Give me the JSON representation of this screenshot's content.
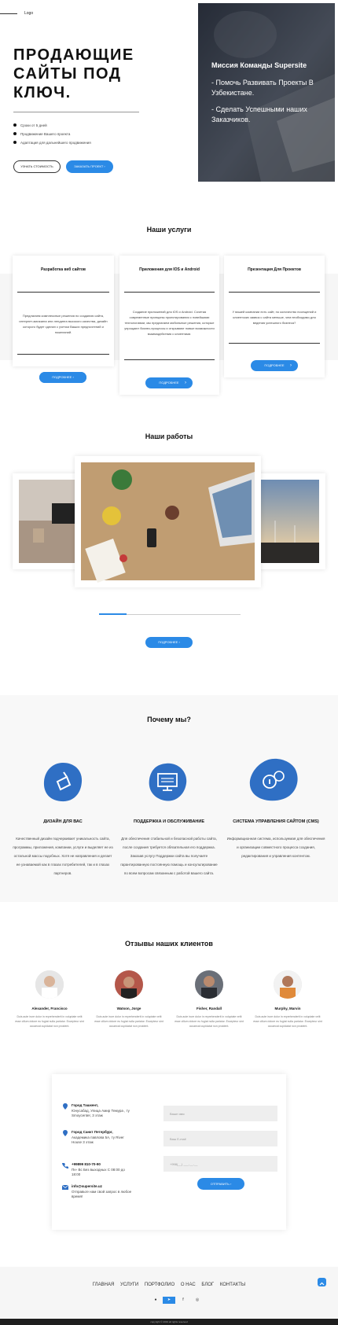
{
  "header": {
    "logo": "Logo"
  },
  "hero": {
    "title": "ПРОДАЮЩИЕ САЙТЫ ПОД КЛЮЧ.",
    "bullets": [
      "Сроки от 5 дней",
      "Продвижение Вашего проекта",
      "Адаптация для дальнейшего продвижения"
    ],
    "btn_price": "УЗНАТЬ СТОИМОСТЬ",
    "btn_order": "ЗАКАЗАТЬ ПРОЕКТ",
    "mission_title": "Миссия Команды Supersite",
    "mission_1": "- Помочь Развивать Проекты В Узбекистане.",
    "mission_2": "- Сделать Успешными наших Заказчиков."
  },
  "services": {
    "title": "Наши услуги",
    "cards": [
      {
        "title": "Разработка веб сайтов",
        "desc": "Предлагаем комплексные решения по созданию сайта, интернет-магазина или лендинга высокого качества, дизайн которого будет сделан с учетом Ваших предпочтений и пожеланий.",
        "btn": "ПОДРОБНЕЕ"
      },
      {
        "title": "Приложения для IOS и Android",
        "desc": "Создание приложений для iOS и Android. Соче­тая современные принципы проектирования с новейшими технологиями, мы предлагаем мобильные решения, которые упрощают бизнес-процессы и открывают новые возможности взаимодействия с клиентами.",
        "btn": "ПОДРОБНЕЕ"
      },
      {
        "title": "Презентация Для Проектов",
        "desc": "У вашей компании есть сайт, но количество посещений и клиентских заявок с сайта меньше, чем необходимо для ведения успешного бизнеса?",
        "btn": "ПОДРОБНЕЕ"
      }
    ]
  },
  "works": {
    "title": "Наши работы",
    "btn": "ПОДРОБНЕЕ"
  },
  "why": {
    "title": "Почему мы?",
    "items": [
      {
        "title": "ДИЗАЙН ДЛЯ ВАС",
        "desc": "Качественный дизайн подчеркивает уникальность сайта, программы, приложения, компании, услуги и выделяет ее из остальной массы подобных. Хотя не направления и делает ее узнаваемой как в глазах потребителей, так и в глазах партнеров."
      },
      {
        "title": "ПОДДЕРЖКА И ОБСЛУЖИВАНИЕ",
        "desc": "Для обеспечения стабильной и безопасной работы сайта, после создания требуется обязательная его поддержка. Заказав услугу Поддержки сайта вы получаете гарантированную постоянную помощь и консультирование по всем вопросам связанным с работой вашего сайта."
      },
      {
        "title": "СИСТЕМА УПРАВЛЕНИЯ САЙТОМ (CMS)",
        "desc": "Информационная система, используемая для обеспечения и организации совместного процесса создания, редактирования и управления контентом."
      }
    ]
  },
  "reviews": {
    "title": "Отзывы наших клиентов",
    "items": [
      {
        "name": "Alexander, Francisco",
        "text": "Duis aute irure dolor in reprehenderit in voluptate velit esse cillum dolore eu fugiat nulla pariatur. Excepteur sint occaecat cupidatat non proident."
      },
      {
        "name": "Watson, Jorge",
        "text": "Duis aute irure dolor in reprehenderit in voluptate velit esse cillum dolore eu fugiat nulla pariatur. Excepteur sint occaecat cupidatat non proident."
      },
      {
        "name": "Fisher, Randall",
        "text": "Duis aute irure dolor in reprehenderit in voluptate velit esse cillum dolore eu fugiat nulla pariatur. Excepteur sint occaecat cupidatat non proident."
      },
      {
        "name": "Murphy, Marvin",
        "text": "Duis aute irure dolor in reprehenderit in voluptate velit esse cillum dolore eu fugiat nulla pariatur. Excepteur sint occaecat cupidatat non proident."
      }
    ]
  },
  "contact": {
    "addr1_title": "Город Ташкент,",
    "addr1": "Юнусабад, Улица Амир Темура , ту Smoycenter, 3 этаж",
    "addr2_title": "Город Санкт Петербург,",
    "addr2": "Академика павлова 5А, ту River House 3 этаж",
    "phone": "+99899 810-70-90",
    "hours": "Пн- Вс Без выходных С 08:00 до 18:00",
    "email": "info@supersite.uz",
    "email_note": "Отправьте нам свой запрос в любое время!",
    "name_ph": "Ваше имя",
    "email_ph": "Ваш E-mail",
    "phone_ph": "+998(__) ___-__-__",
    "send": "ОТПРАВИТЬ"
  },
  "footer": {
    "nav": [
      "ГЛАВНАЯ",
      "УСЛУГИ",
      "ПОРТФОЛИО",
      "О НАС",
      "БЛОГ",
      "КОНТАКТЫ"
    ],
    "copyright": "copyright © 2019 all rights reserved"
  },
  "colors": {
    "accent": "#2b8ae6"
  }
}
